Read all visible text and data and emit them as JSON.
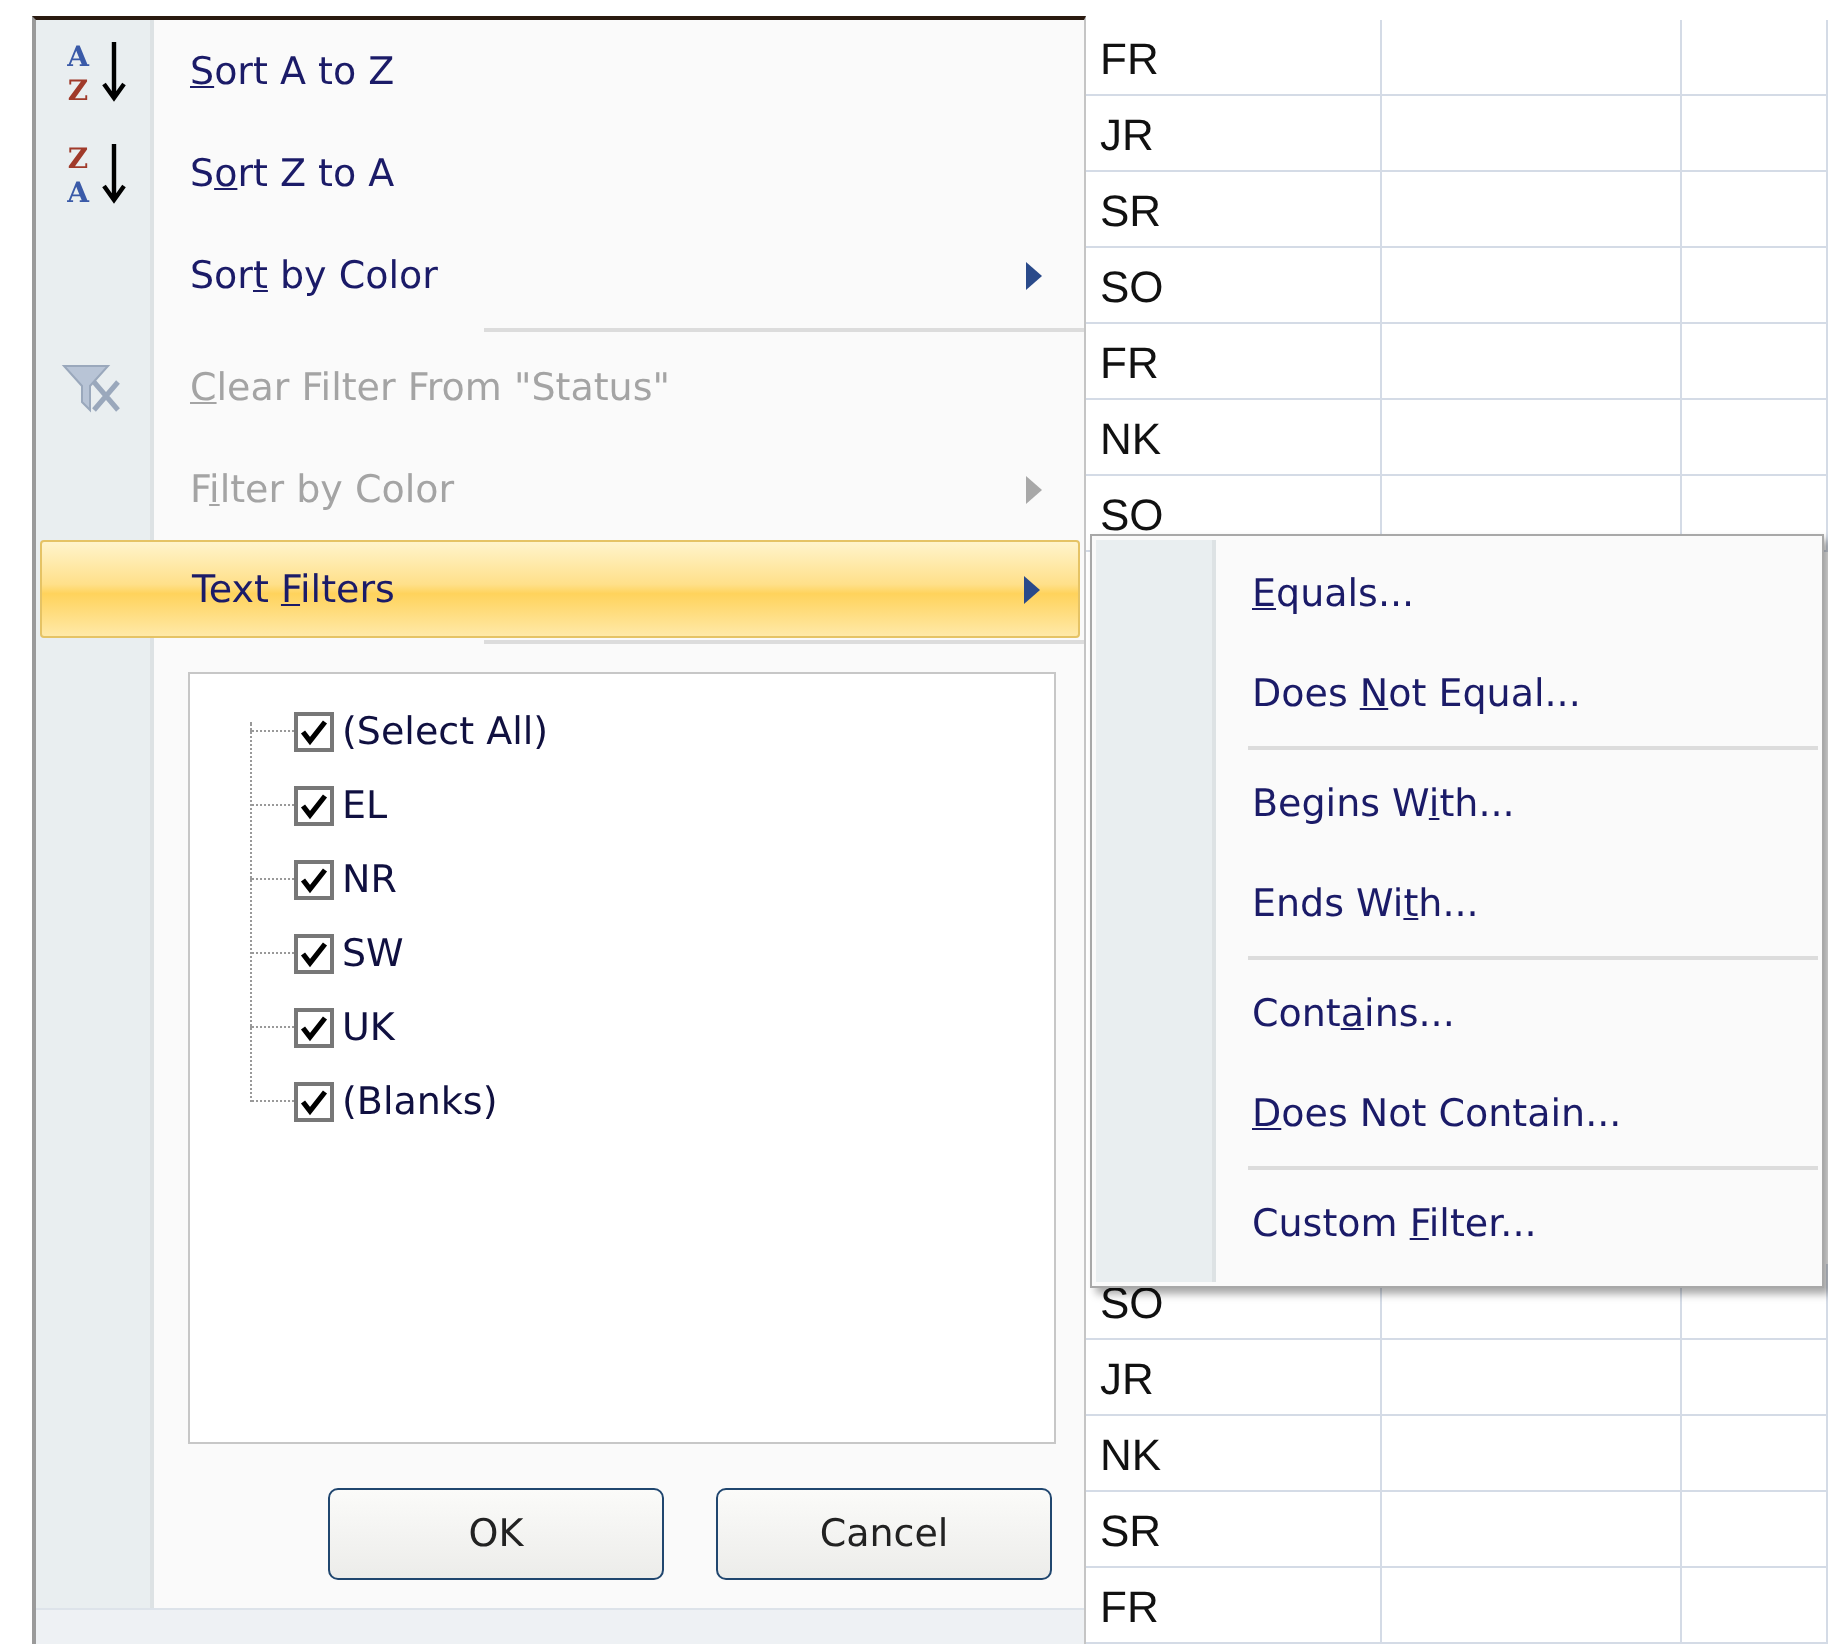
{
  "filter_menu": {
    "groups": [
      [
        {
          "kind": "sort",
          "icon_letters": [
            "A",
            "Z"
          ],
          "label_parts": [
            {
              "text": "S",
              "underlined": true
            },
            {
              "text": "ort A to Z",
              "underlined": false
            }
          ],
          "disabled": false,
          "selected": false
        },
        {
          "kind": "sort",
          "icon_letters": [
            "Z",
            "A"
          ],
          "label_parts": [
            {
              "text": "S",
              "underlined": false
            },
            {
              "text": "o",
              "underlined": true
            },
            {
              "text": "rt Z to A",
              "underlined": false
            }
          ],
          "disabled": false,
          "selected": false
        },
        {
          "kind": "submenu",
          "label_parts": [
            {
              "text": "Sor",
              "underlined": false
            },
            {
              "text": "t",
              "underlined": true
            },
            {
              "text": " by Color",
              "underlined": false
            }
          ],
          "disabled": false,
          "selected": false
        }
      ],
      [
        {
          "kind": "clear",
          "label_parts": [
            {
              "text": "C",
              "underlined": true
            },
            {
              "text": "lear Filter From \"Status\"",
              "underlined": false
            }
          ],
          "disabled": true,
          "selected": false
        },
        {
          "kind": "submenu",
          "label_parts": [
            {
              "text": "F",
              "underlined": false
            },
            {
              "text": "i",
              "underlined": true
            },
            {
              "text": "lter by Color",
              "underlined": false
            }
          ],
          "disabled": true,
          "selected": false
        },
        {
          "kind": "submenu",
          "label_parts": [
            {
              "text": "Text ",
              "underlined": false
            },
            {
              "text": "F",
              "underlined": true
            },
            {
              "text": "ilters",
              "underlined": false
            }
          ],
          "disabled": false,
          "selected": true
        }
      ]
    ],
    "values": [
      {
        "label": "(Select All)",
        "checked": true
      },
      {
        "label": "EL",
        "checked": true
      },
      {
        "label": "NR",
        "checked": true
      },
      {
        "label": "SW",
        "checked": true
      },
      {
        "label": "UK",
        "checked": true
      },
      {
        "label": "(Blanks)",
        "checked": true
      }
    ],
    "buttons": [
      "OK",
      "Cancel"
    ]
  },
  "text_filters_menu": {
    "groups": [
      [
        {
          "label_parts": [
            {
              "text": "E",
              "underlined": true
            },
            {
              "text": "quals...",
              "underlined": false
            }
          ]
        },
        {
          "label_parts": [
            {
              "text": "Does ",
              "underlined": false
            },
            {
              "text": "N",
              "underlined": true
            },
            {
              "text": "ot Equal...",
              "underlined": false
            }
          ]
        }
      ],
      [
        {
          "label_parts": [
            {
              "text": "Begins W",
              "underlined": false
            },
            {
              "text": "i",
              "underlined": true
            },
            {
              "text": "th...",
              "underlined": false
            }
          ]
        },
        {
          "label_parts": [
            {
              "text": "Ends Wi",
              "underlined": false
            },
            {
              "text": "t",
              "underlined": true
            },
            {
              "text": "h...",
              "underlined": false
            }
          ]
        }
      ],
      [
        {
          "label_parts": [
            {
              "text": "Cont",
              "underlined": false
            },
            {
              "text": "a",
              "underlined": true
            },
            {
              "text": "ins...",
              "underlined": false
            }
          ]
        },
        {
          "label_parts": [
            {
              "text": "D",
              "underlined": true
            },
            {
              "text": "oes Not Contain...",
              "underlined": false
            }
          ]
        }
      ],
      [
        {
          "label_parts": [
            {
              "text": "Custom ",
              "underlined": false
            },
            {
              "text": "F",
              "underlined": true
            },
            {
              "text": "ilter...",
              "underlined": false
            }
          ]
        }
      ]
    ]
  },
  "sheet": {
    "rows_top": [
      "FR",
      "JR",
      "SR",
      "SO",
      "FR",
      "NK",
      "SO"
    ],
    "rows_bottom": [
      "SO",
      "JR",
      "NK",
      "SR",
      "FR"
    ]
  }
}
